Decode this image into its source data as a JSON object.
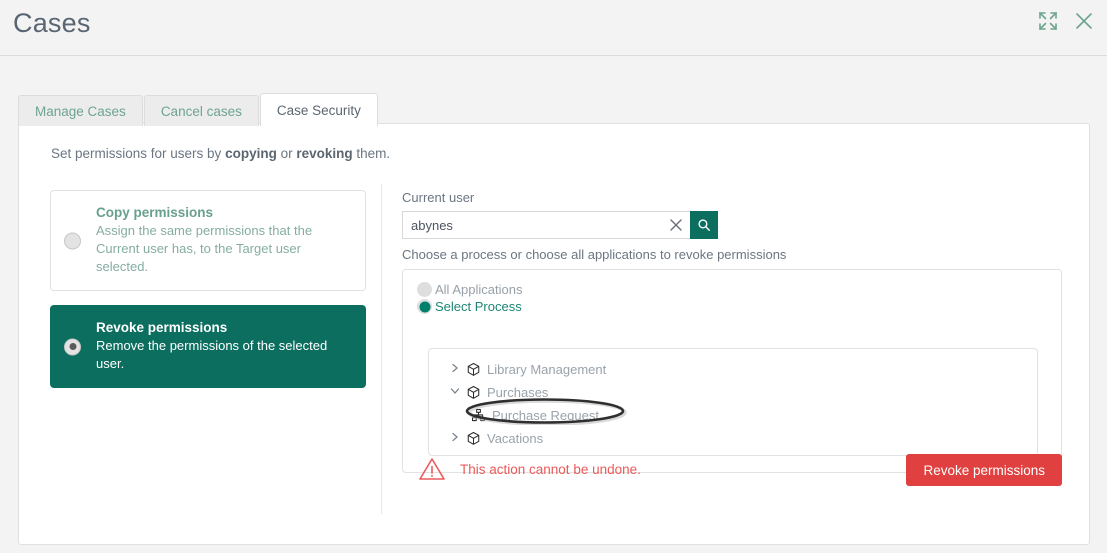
{
  "window": {
    "title": "Cases",
    "expand_icon": "expand-icon",
    "close_icon": "close-icon"
  },
  "tabs": [
    {
      "label": "Manage Cases",
      "active": false
    },
    {
      "label": "Cancel cases",
      "active": false
    },
    {
      "label": "Case Security",
      "active": true
    }
  ],
  "main": {
    "intro_prefix": "Set permissions for users by ",
    "intro_bold1": "copying",
    "intro_mid": " or ",
    "intro_bold2": "revoking",
    "intro_suffix": " them."
  },
  "permission_options": [
    {
      "title": "Copy permissions",
      "description": "Assign the same permissions that the Current user has, to the Target user selected.",
      "selected": false
    },
    {
      "title": "Revoke permissions",
      "description": "Remove the permissions of the selected user.",
      "selected": true
    }
  ],
  "current_user": {
    "label": "Current user",
    "value": "abynes",
    "placeholder": "Current user",
    "clear_icon": "clear-x-icon",
    "search_icon": "search-icon"
  },
  "process_section": {
    "instruction": "Choose a process or choose all applications to revoke permissions",
    "scope_options": [
      {
        "label": "All Applications",
        "selected": false
      },
      {
        "label": "Select Process",
        "selected": true
      }
    ],
    "tree": [
      {
        "label": "Library Management",
        "type": "application",
        "expanded": false,
        "depth": 0,
        "highlighted": false
      },
      {
        "label": "Purchases",
        "type": "application",
        "expanded": true,
        "depth": 0,
        "highlighted": false
      },
      {
        "label": "Purchase Request",
        "type": "process",
        "depth": 1,
        "highlighted": true
      },
      {
        "label": "Vacations",
        "type": "application",
        "expanded": false,
        "depth": 0,
        "highlighted": false
      }
    ]
  },
  "footer": {
    "warning_icon": "warning-triangle-icon",
    "warning_text": "This action cannot be undone.",
    "revoke_button": "Revoke permissions"
  },
  "colors": {
    "teal": "#0b6e5f",
    "teal_accent": "#00806b",
    "tab_text": "#6ea48f",
    "danger": "#e0403f",
    "warning_text": "#eb5a5a",
    "body_text": "#6b7682",
    "page_bg": "#f3f3f3"
  }
}
